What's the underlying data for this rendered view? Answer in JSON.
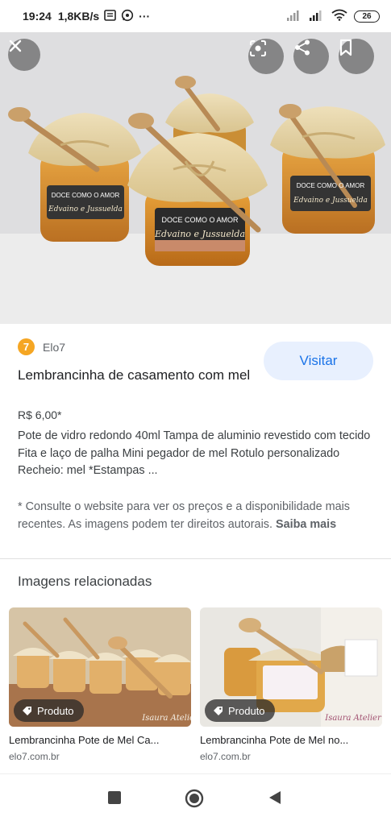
{
  "status_bar": {
    "time": "19:24",
    "speed": "1,8KB/s",
    "more": "···",
    "battery": "26"
  },
  "hero": {
    "label_top": "DOCE COMO O AMOR",
    "label_names": "Edvaino e Jussuelda"
  },
  "result": {
    "source": "Elo7",
    "source_logo_glyph": "7",
    "source_color": "#f5a623",
    "visit_label": "Visitar",
    "title": "Lembrancinha de casamento com mel",
    "price": "R$ 6,00*",
    "description": "Pote de vidro redondo 40ml Tampa de aluminio revestido com tecido Fita e laço de palha Mini pegador de mel Rotulo personalizado Recheio: mel *Estampas ...",
    "disclaimer": "* Consulte o website para ver os preços e a disponibilidade mais recentes. As imagens podem ter direitos autorais.",
    "learn_more": "Saiba mais"
  },
  "related": {
    "title": "Imagens relacionadas",
    "items": [
      {
        "title": "Lembrancinha Pote de Mel Ca...",
        "domain": "elo7.com.br",
        "tag": "Produto",
        "watermark": "Isaura Atelier"
      },
      {
        "title": "Lembrancinha Pote de Mel no...",
        "domain": "elo7.com.br",
        "tag": "Produto",
        "watermark": "Isaura Atelier"
      }
    ]
  },
  "colors": {
    "accent": "#1a73e8",
    "accent_bg": "#e8f0fe"
  },
  "icons": [
    "close-icon",
    "lens-icon",
    "share-icon",
    "bookmark-icon",
    "tag-icon",
    "square-nav-icon",
    "circle-nav-icon",
    "back-nav-icon"
  ]
}
